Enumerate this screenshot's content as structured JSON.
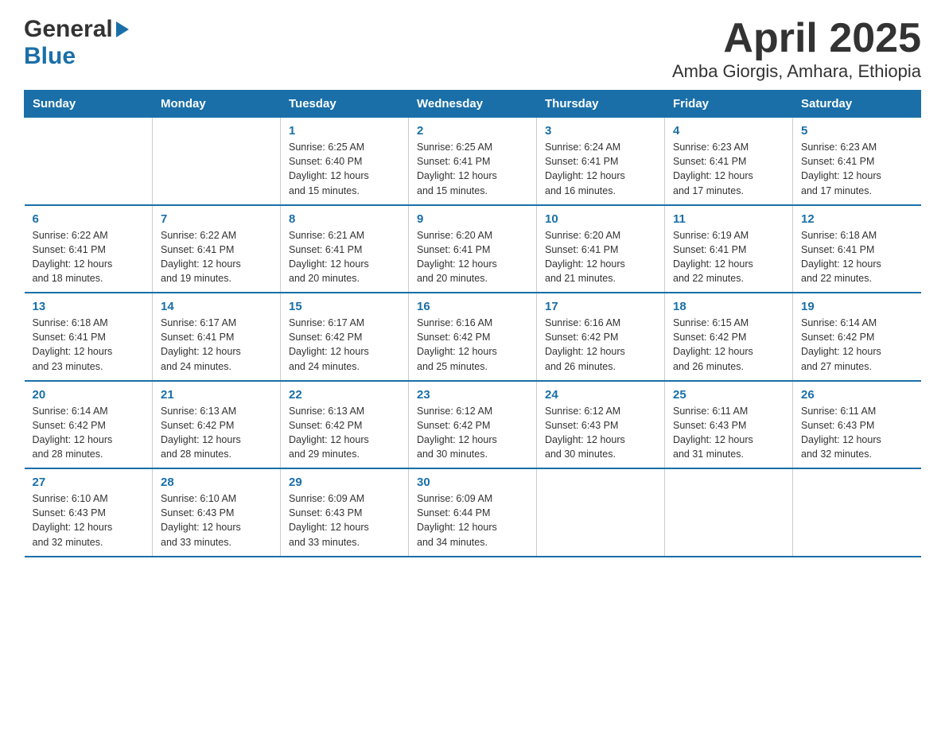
{
  "logo": {
    "general": "General",
    "blue": "Blue"
  },
  "header": {
    "month": "April 2025",
    "location": "Amba Giorgis, Amhara, Ethiopia"
  },
  "days_of_week": [
    "Sunday",
    "Monday",
    "Tuesday",
    "Wednesday",
    "Thursday",
    "Friday",
    "Saturday"
  ],
  "weeks": [
    [
      {
        "day": "",
        "info": ""
      },
      {
        "day": "",
        "info": ""
      },
      {
        "day": "1",
        "info": "Sunrise: 6:25 AM\nSunset: 6:40 PM\nDaylight: 12 hours\nand 15 minutes."
      },
      {
        "day": "2",
        "info": "Sunrise: 6:25 AM\nSunset: 6:41 PM\nDaylight: 12 hours\nand 15 minutes."
      },
      {
        "day": "3",
        "info": "Sunrise: 6:24 AM\nSunset: 6:41 PM\nDaylight: 12 hours\nand 16 minutes."
      },
      {
        "day": "4",
        "info": "Sunrise: 6:23 AM\nSunset: 6:41 PM\nDaylight: 12 hours\nand 17 minutes."
      },
      {
        "day": "5",
        "info": "Sunrise: 6:23 AM\nSunset: 6:41 PM\nDaylight: 12 hours\nand 17 minutes."
      }
    ],
    [
      {
        "day": "6",
        "info": "Sunrise: 6:22 AM\nSunset: 6:41 PM\nDaylight: 12 hours\nand 18 minutes."
      },
      {
        "day": "7",
        "info": "Sunrise: 6:22 AM\nSunset: 6:41 PM\nDaylight: 12 hours\nand 19 minutes."
      },
      {
        "day": "8",
        "info": "Sunrise: 6:21 AM\nSunset: 6:41 PM\nDaylight: 12 hours\nand 20 minutes."
      },
      {
        "day": "9",
        "info": "Sunrise: 6:20 AM\nSunset: 6:41 PM\nDaylight: 12 hours\nand 20 minutes."
      },
      {
        "day": "10",
        "info": "Sunrise: 6:20 AM\nSunset: 6:41 PM\nDaylight: 12 hours\nand 21 minutes."
      },
      {
        "day": "11",
        "info": "Sunrise: 6:19 AM\nSunset: 6:41 PM\nDaylight: 12 hours\nand 22 minutes."
      },
      {
        "day": "12",
        "info": "Sunrise: 6:18 AM\nSunset: 6:41 PM\nDaylight: 12 hours\nand 22 minutes."
      }
    ],
    [
      {
        "day": "13",
        "info": "Sunrise: 6:18 AM\nSunset: 6:41 PM\nDaylight: 12 hours\nand 23 minutes."
      },
      {
        "day": "14",
        "info": "Sunrise: 6:17 AM\nSunset: 6:41 PM\nDaylight: 12 hours\nand 24 minutes."
      },
      {
        "day": "15",
        "info": "Sunrise: 6:17 AM\nSunset: 6:42 PM\nDaylight: 12 hours\nand 24 minutes."
      },
      {
        "day": "16",
        "info": "Sunrise: 6:16 AM\nSunset: 6:42 PM\nDaylight: 12 hours\nand 25 minutes."
      },
      {
        "day": "17",
        "info": "Sunrise: 6:16 AM\nSunset: 6:42 PM\nDaylight: 12 hours\nand 26 minutes."
      },
      {
        "day": "18",
        "info": "Sunrise: 6:15 AM\nSunset: 6:42 PM\nDaylight: 12 hours\nand 26 minutes."
      },
      {
        "day": "19",
        "info": "Sunrise: 6:14 AM\nSunset: 6:42 PM\nDaylight: 12 hours\nand 27 minutes."
      }
    ],
    [
      {
        "day": "20",
        "info": "Sunrise: 6:14 AM\nSunset: 6:42 PM\nDaylight: 12 hours\nand 28 minutes."
      },
      {
        "day": "21",
        "info": "Sunrise: 6:13 AM\nSunset: 6:42 PM\nDaylight: 12 hours\nand 28 minutes."
      },
      {
        "day": "22",
        "info": "Sunrise: 6:13 AM\nSunset: 6:42 PM\nDaylight: 12 hours\nand 29 minutes."
      },
      {
        "day": "23",
        "info": "Sunrise: 6:12 AM\nSunset: 6:42 PM\nDaylight: 12 hours\nand 30 minutes."
      },
      {
        "day": "24",
        "info": "Sunrise: 6:12 AM\nSunset: 6:43 PM\nDaylight: 12 hours\nand 30 minutes."
      },
      {
        "day": "25",
        "info": "Sunrise: 6:11 AM\nSunset: 6:43 PM\nDaylight: 12 hours\nand 31 minutes."
      },
      {
        "day": "26",
        "info": "Sunrise: 6:11 AM\nSunset: 6:43 PM\nDaylight: 12 hours\nand 32 minutes."
      }
    ],
    [
      {
        "day": "27",
        "info": "Sunrise: 6:10 AM\nSunset: 6:43 PM\nDaylight: 12 hours\nand 32 minutes."
      },
      {
        "day": "28",
        "info": "Sunrise: 6:10 AM\nSunset: 6:43 PM\nDaylight: 12 hours\nand 33 minutes."
      },
      {
        "day": "29",
        "info": "Sunrise: 6:09 AM\nSunset: 6:43 PM\nDaylight: 12 hours\nand 33 minutes."
      },
      {
        "day": "30",
        "info": "Sunrise: 6:09 AM\nSunset: 6:44 PM\nDaylight: 12 hours\nand 34 minutes."
      },
      {
        "day": "",
        "info": ""
      },
      {
        "day": "",
        "info": ""
      },
      {
        "day": "",
        "info": ""
      }
    ]
  ]
}
